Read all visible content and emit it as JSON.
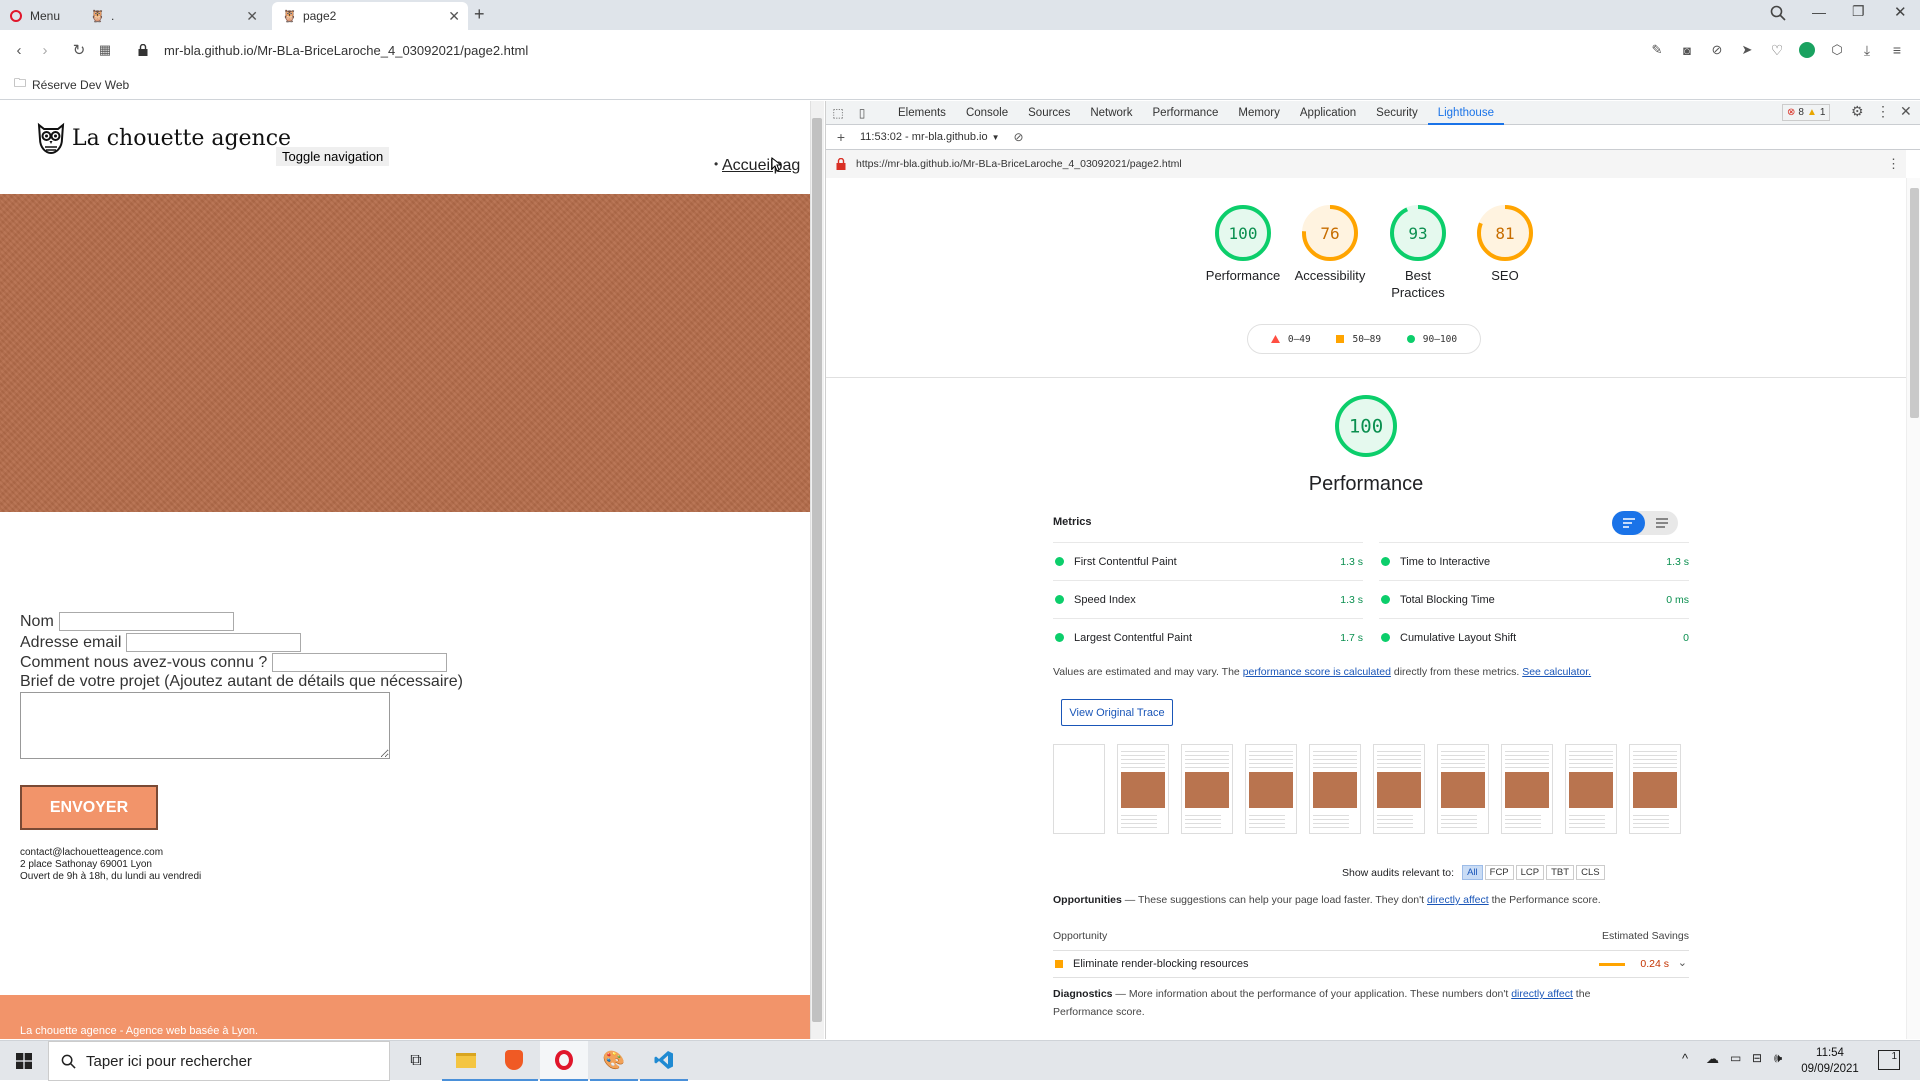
{
  "browser": {
    "tabs": [
      {
        "label": "Menu"
      },
      {
        "label": "."
      },
      {
        "label": "page2"
      }
    ],
    "address": "mr-bla.github.io/Mr-BLa-BriceLaroche_4_03092021/page2.html",
    "bookmark": "Réserve Dev Web"
  },
  "page": {
    "brand": "La chouette agence",
    "toggle": "Toggle navigation",
    "nav_bullet": "•",
    "nav_link": "Accueilpag",
    "form": {
      "nom": "Nom",
      "email": "Adresse email",
      "source": "Comment nous avez-vous connu ?",
      "brief": "Brief de votre projet (Ajoutez autant de détails que nécessaire)",
      "submit": "ENVOYER"
    },
    "contact": [
      "contact@lachouetteagence.com",
      "2 place Sathonay 69001 Lyon",
      "Ouvert de 9h à 18h, du lundi au vendredi"
    ],
    "footer": "La chouette agence - Agence web basée à Lyon."
  },
  "devtools": {
    "tabs": [
      "Elements",
      "Console",
      "Sources",
      "Network",
      "Performance",
      "Memory",
      "Application",
      "Security",
      "Lighthouse"
    ],
    "active_tab": "Lighthouse",
    "errors": "8",
    "warnings": "1",
    "report_select": "11:53:02 - mr-bla.github.io",
    "report_url": "https://mr-bla.github.io/Mr-BLa-BriceLaroche_4_03092021/page2.html"
  },
  "lighthouse": {
    "colors": {
      "pass": "#0cce6b",
      "average": "#ffa400",
      "fail": "#ff4e42"
    },
    "scores": [
      {
        "label": "Performance",
        "score": 100,
        "status": "pass"
      },
      {
        "label": "Accessibility",
        "score": 76,
        "status": "average"
      },
      {
        "label": "Best Practices",
        "score": 93,
        "status": "pass"
      },
      {
        "label": "SEO",
        "score": 81,
        "status": "average"
      }
    ],
    "legend": [
      "0–49",
      "50–89",
      "90–100"
    ],
    "main_score": 100,
    "main_title": "Performance",
    "metrics_heading": "Metrics",
    "metrics": [
      {
        "name": "First Contentful Paint",
        "value": "1.3 s"
      },
      {
        "name": "Time to Interactive",
        "value": "1.3 s"
      },
      {
        "name": "Speed Index",
        "value": "1.3 s"
      },
      {
        "name": "Total Blocking Time",
        "value": "0 ms"
      },
      {
        "name": "Largest Contentful Paint",
        "value": "1.7 s"
      },
      {
        "name": "Cumulative Layout Shift",
        "value": "0"
      }
    ],
    "note_a": "Values are estimated and may vary. The ",
    "note_link1": "performance score is calculated",
    "note_b": " directly from these metrics. ",
    "note_link2": "See calculator.",
    "trace_button": "View Original Trace",
    "show_audits": "Show audits relevant to:",
    "chips": [
      "All",
      "FCP",
      "LCP",
      "TBT",
      "CLS"
    ],
    "opportunities_title": "Opportunities",
    "opportunities_a": " — These suggestions can help your page load faster. They don't ",
    "opportunities_link": "directly affect",
    "opportunities_b": " the Performance score.",
    "opp_col1": "Opportunity",
    "opp_col2": "Estimated Savings",
    "opp_item": "Eliminate render-blocking resources",
    "opp_value": "0.24 s",
    "diagnostics_title": "Diagnostics",
    "diagnostics_a": " — More information about the performance of your application. These numbers don't ",
    "diagnostics_link": "directly affect",
    "diagnostics_b": " the",
    "diagnostics_c": "Performance score."
  },
  "taskbar": {
    "search": "Taper ici pour rechercher",
    "time": "11:54",
    "date": "09/09/2021",
    "notifications": "1"
  }
}
